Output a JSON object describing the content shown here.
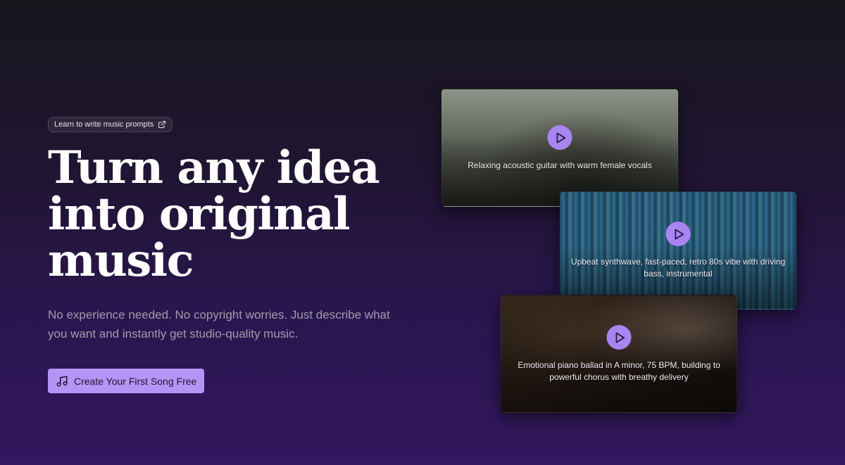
{
  "hero": {
    "learn_link_label": "Learn to write music prompts",
    "headline_lines": [
      "Turn any idea",
      "into original",
      "music"
    ],
    "subcopy": "No experience needed. No copyright worries. Just describe what you want and instantly get studio-quality music.",
    "cta_label": "Create Your First Song Free"
  },
  "cards": [
    {
      "caption": "Relaxing acoustic guitar with warm female vocals"
    },
    {
      "caption": "Upbeat synthwave, fast-paced, retro 80s vibe with driving bass, instrumental"
    },
    {
      "caption": "Emotional piano ballad in A minor, 75 BPM, building to powerful chorus with breathy delivery"
    }
  ],
  "icons": {
    "external_link": "external-link-icon",
    "music_note": "music-note-icon",
    "play": "play-icon"
  },
  "colors": {
    "accent": "#b694f5",
    "play_button": "#a985f2"
  }
}
